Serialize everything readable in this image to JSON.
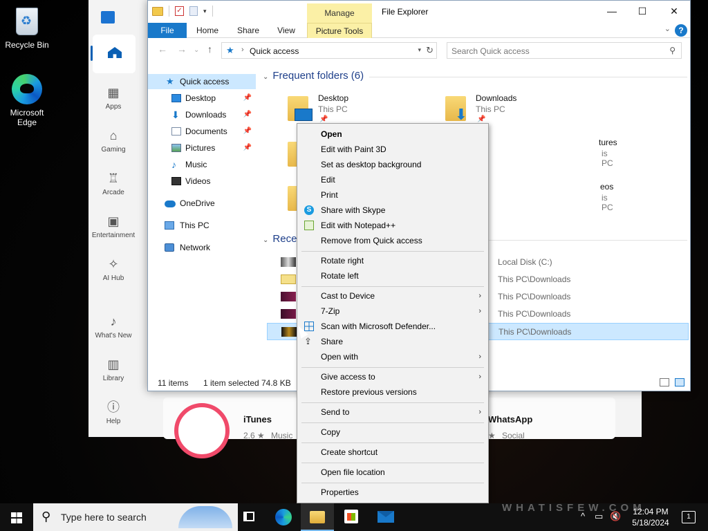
{
  "desktop": {
    "icons": [
      {
        "label": "Recycle Bin"
      },
      {
        "label": "Microsoft Edge"
      }
    ]
  },
  "store": {
    "nav": [
      {
        "label": "Apps"
      },
      {
        "label": "Gaming"
      },
      {
        "label": "Arcade"
      },
      {
        "label": "Entertainment"
      },
      {
        "label": "AI Hub"
      },
      {
        "label": "What's New"
      },
      {
        "label": "Library"
      },
      {
        "label": "Help"
      }
    ],
    "cards": [
      {
        "name": "iTunes",
        "rating": "2.6 ★",
        "category": "Music"
      },
      {
        "name": "WhatsApp",
        "rating": "★",
        "category": "Social"
      }
    ]
  },
  "explorer": {
    "window_title": "File Explorer",
    "manage_tab": "Manage",
    "tabs": [
      "File",
      "Home",
      "Share",
      "View",
      "Picture Tools"
    ],
    "help": "?",
    "address": {
      "location": "Quick access"
    },
    "search": {
      "placeholder": "Search Quick access"
    },
    "nav_pane": [
      {
        "label": "Quick access"
      },
      {
        "label": "Desktop"
      },
      {
        "label": "Downloads"
      },
      {
        "label": "Documents"
      },
      {
        "label": "Pictures"
      },
      {
        "label": "Music"
      },
      {
        "label": "Videos"
      },
      {
        "label": "OneDrive"
      },
      {
        "label": "This PC"
      },
      {
        "label": "Network"
      }
    ],
    "frequent_header": "Frequent folders (6)",
    "frequent": [
      {
        "name": "Desktop",
        "location": "This PC"
      },
      {
        "name": "Downloads",
        "location": "This PC"
      },
      {
        "name": "tures",
        "location": "is PC"
      },
      {
        "name": "eos",
        "location": "is PC"
      }
    ],
    "recent_header": "Recen",
    "recent": [
      {
        "location": "Local Disk (C:)"
      },
      {
        "location": "This PC\\Downloads"
      },
      {
        "location": "This PC\\Downloads"
      },
      {
        "location": "This PC\\Downloads"
      },
      {
        "location": "This PC\\Downloads"
      }
    ],
    "status": {
      "items": "11 items",
      "selected": "1 item selected",
      "size": "74.8 KB"
    }
  },
  "context_menu": {
    "items": [
      {
        "label": "Open"
      },
      {
        "label": "Edit with Paint 3D"
      },
      {
        "label": "Set as desktop background"
      },
      {
        "label": "Edit"
      },
      {
        "label": "Print"
      },
      {
        "label": "Share with Skype"
      },
      {
        "label": "Edit with Notepad++"
      },
      {
        "label": "Remove from Quick access"
      },
      {
        "label": "Rotate right"
      },
      {
        "label": "Rotate left"
      },
      {
        "label": "Cast to Device"
      },
      {
        "label": "7-Zip"
      },
      {
        "label": "Scan with Microsoft Defender..."
      },
      {
        "label": "Share"
      },
      {
        "label": "Open with"
      },
      {
        "label": "Give access to"
      },
      {
        "label": "Restore previous versions"
      },
      {
        "label": "Send to"
      },
      {
        "label": "Copy"
      },
      {
        "label": "Create shortcut"
      },
      {
        "label": "Open file location"
      },
      {
        "label": "Properties"
      }
    ]
  },
  "taskbar": {
    "search_placeholder": "Type here to search",
    "time": "12:04 PM",
    "date": "5/18/2024",
    "notifications": "1"
  },
  "watermark": "WHATISFEW.COM"
}
